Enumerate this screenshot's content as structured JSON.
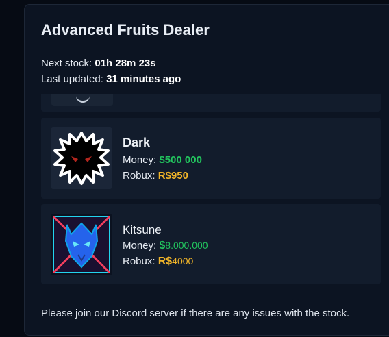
{
  "page": {
    "title": "Advanced Fruits Dealer",
    "next_stock_label": "Next stock:",
    "next_stock_value": "01h 28m 23s",
    "last_updated_label": "Last updated:",
    "last_updated_value": "31 minutes ago",
    "footer": "Please join our Discord server if there are any issues with the stock."
  },
  "fruits": [
    {
      "name": "Dark",
      "money_label": "Money:",
      "money_value": "$500 000",
      "robux_label": "Robux:",
      "robux_value": "R$950",
      "icon": "dark-fruit-icon"
    },
    {
      "name": "Kitsune",
      "money_label": "Money:",
      "money_symbol": "$",
      "money_value": "8.000.000",
      "robux_label": "Robux:",
      "robux_symbol": "R$",
      "robux_value": "4000",
      "icon": "kitsune-fruit-icon"
    }
  ],
  "colors": {
    "money": "#22c55e",
    "robux": "#f0b429",
    "card": "#121c2c",
    "panel": "#0c1422"
  }
}
